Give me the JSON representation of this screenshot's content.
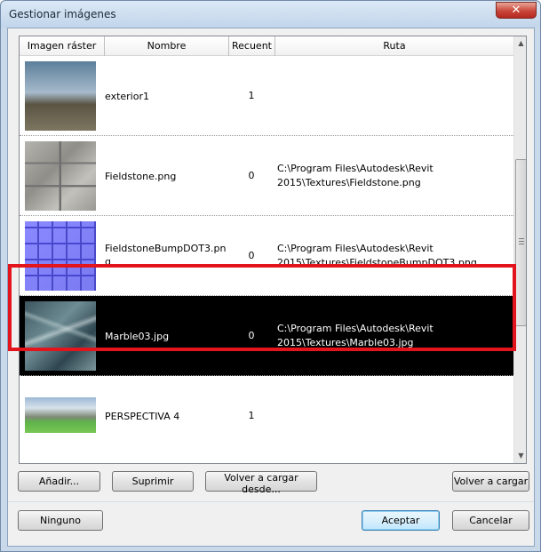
{
  "window": {
    "title": "Gestionar imágenes",
    "close_glyph": "✕"
  },
  "list": {
    "columns": [
      "Imagen ráster",
      "Nombre",
      "Recuent",
      "Ruta"
    ],
    "rows": [
      {
        "name": "exterior1",
        "count": "1",
        "path_line1": "",
        "path_line2": "",
        "thumb": "building",
        "selected": false
      },
      {
        "name": "Fieldstone.png",
        "count": "0",
        "path_line1": "C:\\Program Files\\Autodesk\\Revit",
        "path_line2": "2015\\Textures\\Fieldstone.png",
        "thumb": "stone",
        "selected": false
      },
      {
        "name_line1": "FieldstoneBumpDOT3.pn",
        "name_line2": "g",
        "count": "0",
        "path_line1": "C:\\Program Files\\Autodesk\\Revit",
        "path_line2": "2015\\Textures\\FieldstoneBumpDOT3.png",
        "thumb": "bump",
        "selected": false
      },
      {
        "name": "Marble03.jpg",
        "count": "0",
        "path_line1": "C:\\Program Files\\Autodesk\\Revit",
        "path_line2": "2015\\Textures\\Marble03.jpg",
        "thumb": "marble",
        "selected": true
      },
      {
        "name": "PERSPECTIVA 4",
        "count": "1",
        "path_line1": "",
        "path_line2": "",
        "thumb": "perspective",
        "selected": false
      }
    ]
  },
  "buttons": {
    "add": "Añadir...",
    "delete": "Suprimir",
    "reload_from": "Volver a cargar desde...",
    "reload": "Volver a cargar",
    "none": "Ninguno",
    "accept": "Aceptar",
    "cancel": "Cancelar"
  },
  "colors": {
    "selection_outline": "#e3141b",
    "selected_row_bg": "#000000"
  }
}
